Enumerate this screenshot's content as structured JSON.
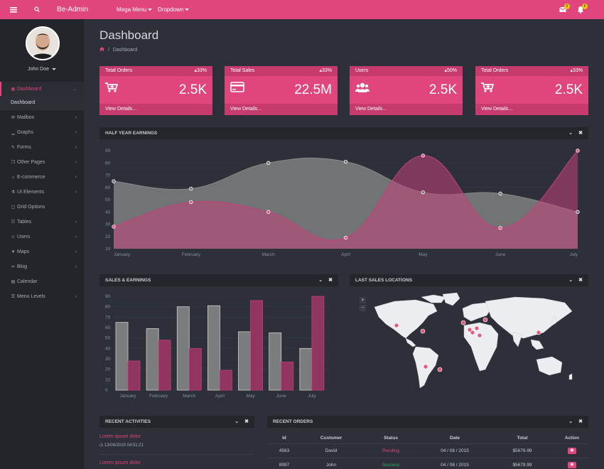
{
  "topbar": {
    "brand": "Be-Admin",
    "menu1": "Mega Menu",
    "menu2": "Dropdown",
    "mail_count": "6",
    "notif_count": "6"
  },
  "sidebar": {
    "user": "John Doe",
    "items": [
      {
        "label": "Dashboard",
        "icon": "grid-icon"
      },
      {
        "label": "Mailbox",
        "icon": "envelope-icon"
      },
      {
        "label": "Graphs",
        "icon": "bar-chart-icon"
      },
      {
        "label": "Forms",
        "icon": "edit-icon"
      },
      {
        "label": "Other Pages",
        "icon": "copy-icon"
      },
      {
        "label": "E-commerce",
        "icon": "cart-icon"
      },
      {
        "label": "UI Elements",
        "icon": "flask-icon"
      },
      {
        "label": "Grid Options",
        "icon": "grid-options-icon"
      },
      {
        "label": "Tables",
        "icon": "table-icon"
      },
      {
        "label": "Users",
        "icon": "users-icon"
      },
      {
        "label": "Maps",
        "icon": "map-marker-icon"
      },
      {
        "label": "Blog",
        "icon": "pencil-icon"
      },
      {
        "label": "Calendar",
        "icon": "calendar-icon"
      },
      {
        "label": "Menu Levels",
        "icon": "sitemap-icon"
      }
    ],
    "submenu": "Dashboard"
  },
  "page": {
    "title": "Dashboard",
    "breadcrumb": "Dashboard"
  },
  "stats": [
    {
      "title": "Total Orders",
      "pct": "33%",
      "value": "2.5K",
      "link": "View Details...",
      "icon": "cart-plus-icon"
    },
    {
      "title": "Total Sales",
      "pct": "33%",
      "value": "22.5M",
      "link": "View Details...",
      "icon": "credit-card-icon"
    },
    {
      "title": "Users",
      "pct": "50%",
      "value": "2.5K",
      "link": "View Details...",
      "icon": "users-icon"
    },
    {
      "title": "Total Orders",
      "pct": "33%",
      "value": "2.5K",
      "link": "View Details...",
      "icon": "cart-plus-icon"
    }
  ],
  "panels": {
    "earnings": "HALF YEAR EARNINGS",
    "sales": "SALES & EARNINGS",
    "locations": "LAST SALES LOCATIONS",
    "activities": "RECENT ACTIVITIES",
    "orders": "RECENT ORDERS"
  },
  "chart_data": [
    {
      "type": "area",
      "categories": [
        "January",
        "February",
        "March",
        "April",
        "May",
        "June",
        "July"
      ],
      "ylim": [
        10,
        90
      ],
      "yticks": [
        "90",
        "80",
        "70",
        "60",
        "50",
        "40",
        "30",
        "20",
        "10"
      ],
      "series": [
        {
          "values": [
            65,
            59,
            80,
            81,
            56,
            55,
            40
          ],
          "color": "#8a8a8a"
        },
        {
          "values": [
            28,
            48,
            40,
            19,
            86,
            27,
            90
          ],
          "color": "#c2417a"
        }
      ]
    },
    {
      "type": "bar",
      "categories": [
        "January",
        "February",
        "March",
        "April",
        "May",
        "June",
        "July"
      ],
      "ylim": [
        0,
        90
      ],
      "yticks": [
        "90",
        "80",
        "70",
        "60",
        "50",
        "40",
        "30",
        "20",
        "10",
        "0"
      ],
      "series": [
        {
          "values": [
            65,
            59,
            80,
            81,
            56,
            55,
            40
          ],
          "color": "#8a8a8a"
        },
        {
          "values": [
            28,
            48,
            40,
            19,
            86,
            27,
            90
          ],
          "color": "#9b3665"
        }
      ]
    }
  ],
  "activities": [
    {
      "title": "Lorem ipsum dolor",
      "time": "13/08/2015 04:51:21"
    },
    {
      "title": "Lorem ipsum dolor",
      "time": ""
    }
  ],
  "orders": {
    "headers": [
      "Id",
      "Customer",
      "Status",
      "Date",
      "Total",
      "Action"
    ],
    "rows": [
      {
        "id": "4563",
        "customer": "David",
        "status": "Pending",
        "date": "04 / 08 / 2015",
        "total": "$5679.99"
      },
      {
        "id": "8997",
        "customer": "John",
        "status": "Success",
        "date": "04 / 08 / 2015",
        "total": "$5679.99"
      }
    ]
  }
}
